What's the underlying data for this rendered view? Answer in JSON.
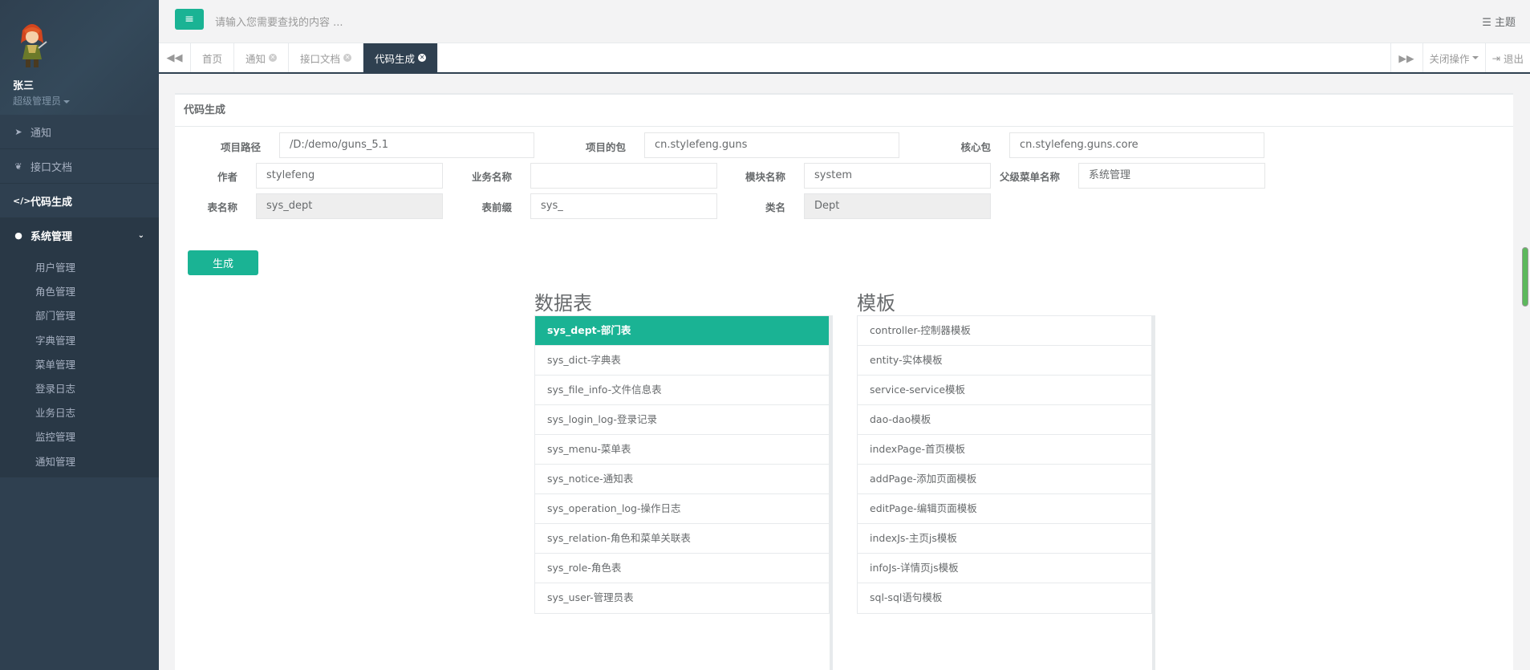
{
  "sidebar": {
    "user_name": "张三",
    "user_role": "超级管理员",
    "nav": [
      {
        "label": "通知",
        "icon": "paper-plane-icon"
      },
      {
        "label": "接口文档",
        "icon": "leaf-icon"
      },
      {
        "label": "代码生成",
        "icon": "code-icon"
      }
    ],
    "system": {
      "label": "系统管理",
      "icon": "user-icon",
      "items": [
        "用户管理",
        "角色管理",
        "部门管理",
        "字典管理",
        "菜单管理",
        "登录日志",
        "业务日志",
        "监控管理",
        "通知管理"
      ]
    }
  },
  "header": {
    "search_placeholder": "请输入您需要查找的内容 ...",
    "theme_label": "主题"
  },
  "tabs": {
    "items": [
      "首页",
      "通知",
      "接口文档",
      "代码生成"
    ],
    "active": "代码生成",
    "close_ops": "关闭操作",
    "logout": "退出"
  },
  "form": {
    "title": "代码生成",
    "project_path_label": "项目路径",
    "project_path": "/D:/demo/guns_5.1",
    "project_pkg_label": "项目的包",
    "project_pkg": "cn.stylefeng.guns",
    "core_pkg_label": "核心包",
    "core_pkg": "cn.stylefeng.guns.core",
    "author_label": "作者",
    "author": "stylefeng",
    "biz_name_label": "业务名称",
    "biz_name": "",
    "module_label": "模块名称",
    "module": "system",
    "parent_menu_label": "父级菜单名称",
    "parent_menu": "系统管理",
    "table_name_label": "表名称",
    "table_name": "sys_dept",
    "table_prefix_label": "表前缀",
    "table_prefix": "sys_",
    "class_name_label": "类名",
    "class_name": "Dept",
    "generate_label": "生成"
  },
  "tables": {
    "title": "数据表",
    "items": [
      "sys_dept-部门表",
      "sys_dict-字典表",
      "sys_file_info-文件信息表",
      "sys_login_log-登录记录",
      "sys_menu-菜单表",
      "sys_notice-通知表",
      "sys_operation_log-操作日志",
      "sys_relation-角色和菜单关联表",
      "sys_role-角色表",
      "sys_user-管理员表"
    ],
    "selected": "sys_dept-部门表"
  },
  "templates": {
    "title": "模板",
    "items": [
      "controller-控制器模板",
      "entity-实体模板",
      "service-service模板",
      "dao-dao模板",
      "indexPage-首页模板",
      "addPage-添加页面模板",
      "editPage-编辑页面模板",
      "indexJs-主页js模板",
      "infoJs-详情页js模板",
      "sql-sql语句模板"
    ]
  },
  "colors": {
    "accent": "#1ab394",
    "sidebar": "#2f4050"
  }
}
